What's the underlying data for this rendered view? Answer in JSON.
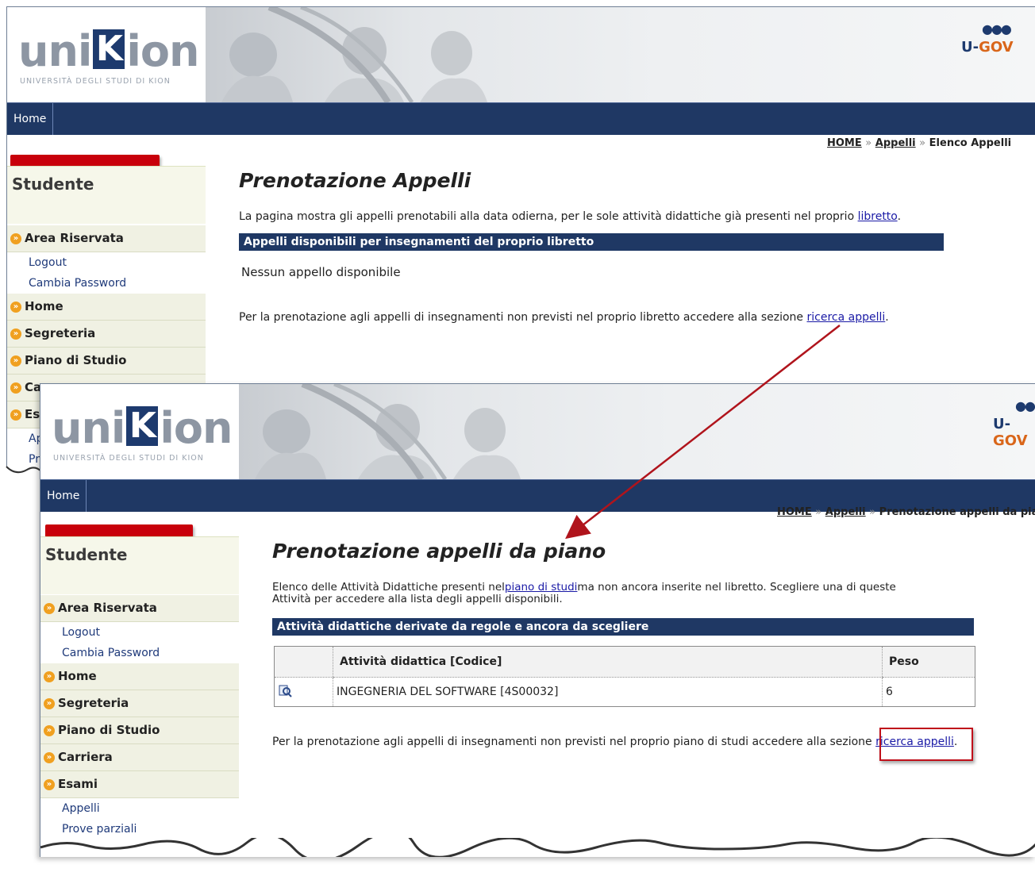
{
  "win1": {
    "logo": {
      "brand_left": "uni",
      "brand_k": "K",
      "brand_right": "ion",
      "subtitle": "UNIVERSITÀ DEGLI STUDI DI KION"
    },
    "ugov": {
      "u": "U-",
      "gov": "GOV"
    },
    "nav_home": "Home",
    "breadcrumb": {
      "home": "HOME",
      "sep": "»",
      "appelli": "Appelli",
      "current": "Elenco Appelli"
    },
    "sidebar": {
      "title": "Studente",
      "items": [
        "Area Riservata",
        "Home",
        "Segreteria",
        "Piano di Studio",
        "Ca",
        "Esa"
      ],
      "subitems": [
        "Logout",
        "Cambia Password"
      ],
      "esa_subitems": [
        "Ap",
        "Pr"
      ]
    },
    "page_title": "Prenotazione Appelli",
    "intro_text": "La pagina mostra gli appelli prenotabili alla data odierna, per le sole attività didattiche già presenti nel proprio",
    "intro_link": "libretto",
    "intro_end": ".",
    "section_title": "Appelli disponibili per insegnamenti del proprio libretto",
    "no_results": "Nessun appello disponibile",
    "footer_text": "Per la prenotazione agli appelli di insegnamenti non previsti nel proprio libretto accedere alla sezione",
    "footer_link": "ricerca appelli",
    "footer_end": "."
  },
  "win2": {
    "logo": {
      "brand_left": "uni",
      "brand_k": "K",
      "brand_right": "ion",
      "subtitle": "UNIVERSITÀ DEGLI STUDI DI KION"
    },
    "ugov": {
      "u": "U-",
      "gov": "GOV"
    },
    "nav_home": "Home",
    "breadcrumb": {
      "home": "HOME",
      "sep": "»",
      "appelli": "Appelli",
      "current": "Prenotazione appelli da piano"
    },
    "sidebar": {
      "title": "Studente",
      "area": "Area Riservata",
      "logout": "Logout",
      "cambia": "Cambia Password",
      "home": "Home",
      "segreteria": "Segreteria",
      "piano": "Piano di Studio",
      "carriera": "Carriera",
      "esami": "Esami",
      "appelli": "Appelli",
      "prove": "Prove parziali"
    },
    "page_title": "Prenotazione appelli da piano",
    "intro_a": "Elenco delle Attività Didattiche presenti nel",
    "intro_link": "piano di studi",
    "intro_b": "ma non ancora inserite nel libretto. Scegliere una di queste",
    "intro_c": "Attività per accedere alla lista degli appelli disponibili.",
    "section_title": "Attività didattiche derivate da regole e ancora da scegliere",
    "table": {
      "headers": [
        "",
        "Attività didattica [Codice]",
        "Peso"
      ],
      "rows": [
        {
          "activity": "INGEGNERIA DEL SOFTWARE [4S00032]",
          "peso": "6"
        }
      ]
    },
    "footer_text": "Per la prenotazione agli appelli di insegnamenti non previsti nel proprio piano di studi accedere alla sezione",
    "footer_link": "ricerca appelli",
    "footer_end": "."
  },
  "colors": {
    "navy": "#1f3864",
    "red": "#c0101a",
    "link": "#1a1aa6",
    "menu_bg": "#f0f1e3"
  }
}
